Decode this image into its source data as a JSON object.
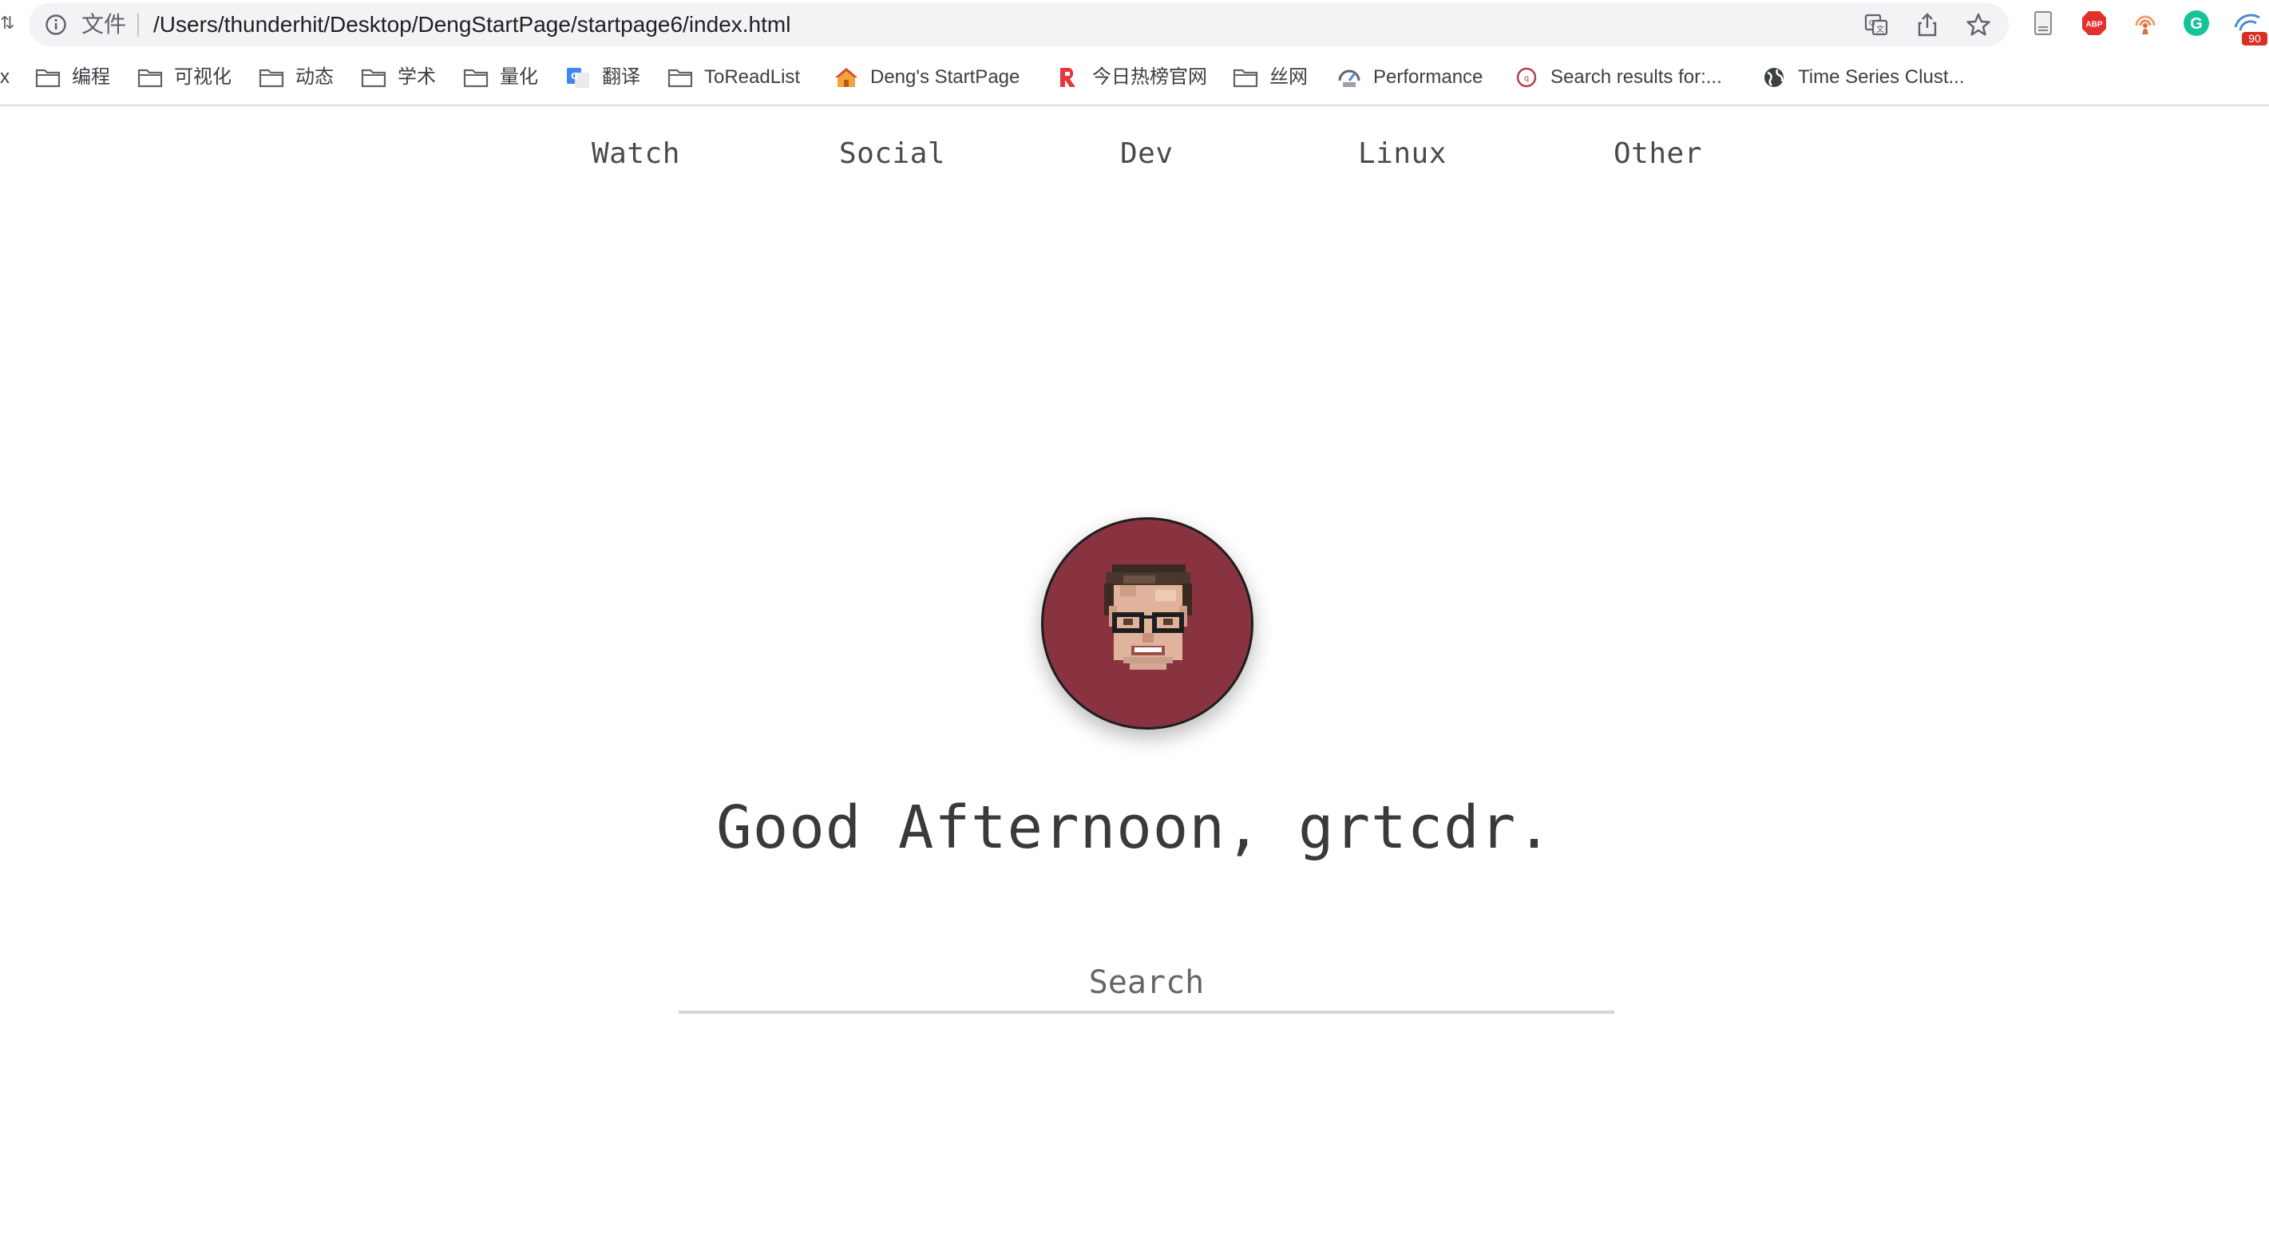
{
  "browser": {
    "left_edge_glyph": "⇅",
    "file_label": "文件",
    "url": "/Users/thunderhit/Desktop/DengStartPage/startpage6/index.html",
    "extension_badge": "90",
    "abp_label": "ABP",
    "grammarly_label": "G",
    "left_cut_label": "x"
  },
  "bookmarks": [
    {
      "label": "编程",
      "icon": "folder-icon"
    },
    {
      "label": "可视化",
      "icon": "folder-icon"
    },
    {
      "label": "动态",
      "icon": "folder-icon"
    },
    {
      "label": "学术",
      "icon": "folder-icon"
    },
    {
      "label": "量化",
      "icon": "folder-icon"
    },
    {
      "label": "翻译",
      "icon": "google-translate-icon"
    },
    {
      "label": "ToReadList",
      "icon": "folder-icon"
    },
    {
      "label": "Deng's StartPage",
      "icon": "home-icon"
    },
    {
      "label": "今日热榜官网",
      "icon": "tophub-icon"
    },
    {
      "label": "丝网",
      "icon": "folder-icon"
    },
    {
      "label": "Performance",
      "icon": "performance-icon"
    },
    {
      "label": "Search results for:...",
      "icon": "site-icon"
    },
    {
      "label": "Time Series Clust...",
      "icon": "globe-icon"
    }
  ],
  "nav": {
    "links": [
      "Watch",
      "Social",
      "Dev",
      "Linux",
      "Other"
    ]
  },
  "greeting": "Good Afternoon, grtcdr.",
  "search": {
    "placeholder": "Search",
    "value": ""
  },
  "colors": {
    "avatar_bg": "#8a3340",
    "text": "#3a3a3a",
    "search_border": "#d6d6d6"
  }
}
